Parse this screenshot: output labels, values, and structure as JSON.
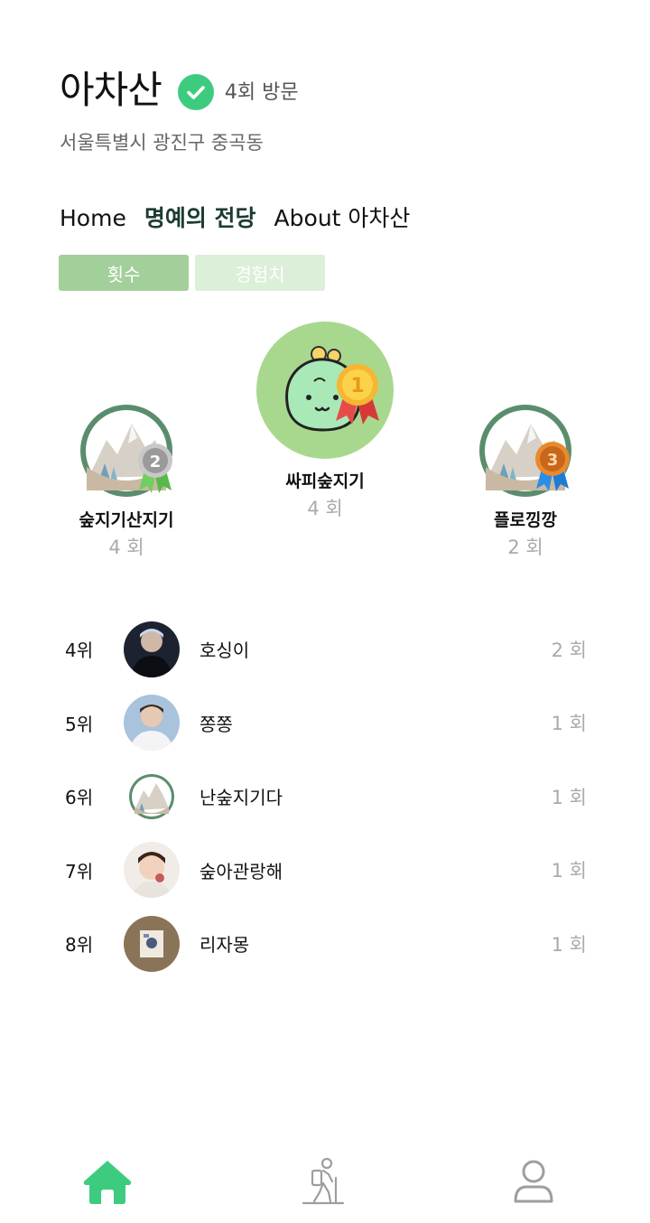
{
  "header": {
    "mountain_name": "아차산",
    "visit_count": "4회 방문",
    "address": "서울특별시 광진구 중곡동"
  },
  "nav": {
    "tabs": [
      {
        "label": "Home"
      },
      {
        "label": "명예의 전당"
      },
      {
        "label": "About 아차산"
      }
    ],
    "active": "명예의 전당"
  },
  "segment": {
    "options": [
      {
        "label": "횟수"
      },
      {
        "label": "경험치"
      }
    ],
    "selected": "횟수"
  },
  "podium": {
    "first": {
      "name": "싸피숲지기",
      "count": "4 회",
      "medal": "1"
    },
    "second": {
      "name": "숲지기산지기",
      "count": "4 회",
      "medal": "2"
    },
    "third": {
      "name": "플로낑깡",
      "count": "2 회",
      "medal": "3"
    }
  },
  "ranking": [
    {
      "rank": "4위",
      "name": "호싱이",
      "count": "2 회"
    },
    {
      "rank": "5위",
      "name": "쫑쫑",
      "count": "1 회"
    },
    {
      "rank": "6위",
      "name": "난숲지기다",
      "count": "1 회"
    },
    {
      "rank": "7위",
      "name": "숲아관랑해",
      "count": "1 회"
    },
    {
      "rank": "8위",
      "name": "리자몽",
      "count": "1 회"
    }
  ],
  "bottom_nav": [
    {
      "icon": "home-icon",
      "active": true
    },
    {
      "icon": "hiker-icon",
      "active": false
    },
    {
      "icon": "profile-icon",
      "active": false
    }
  ],
  "colors": {
    "accent": "#3dcc7f",
    "segment_on": "#a3cf9a",
    "segment_off": "#dcefd8",
    "muted": "#aaaaaa"
  }
}
